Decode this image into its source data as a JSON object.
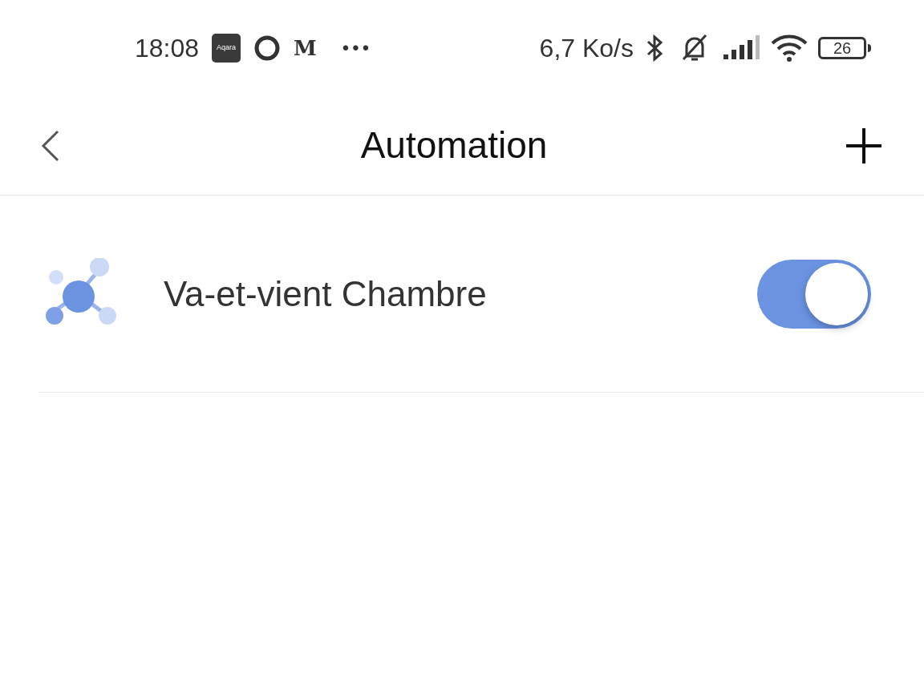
{
  "status_bar": {
    "time": "18:08",
    "app_icons": [
      {
        "kind": "badge",
        "label": "Aqara"
      },
      {
        "kind": "ring"
      },
      {
        "kind": "letter",
        "label": "M"
      }
    ],
    "more": "•••",
    "speed": "6,7 Ko/s",
    "battery": "26"
  },
  "header": {
    "title": "Automation"
  },
  "automations": [
    {
      "name": "Va-et-vient Chambre",
      "on": true
    }
  ]
}
